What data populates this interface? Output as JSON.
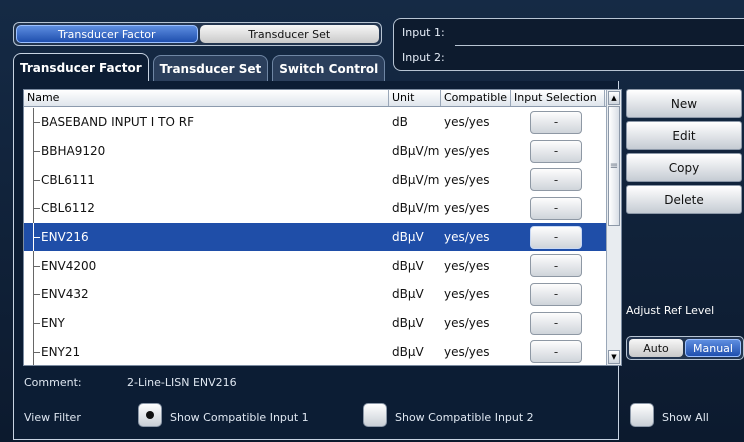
{
  "mode_toggle": {
    "factor_label": "Transducer Factor",
    "set_label": "Transducer Set"
  },
  "inputs": {
    "input1_label": "Input 1:",
    "input2_label": "Input 2:"
  },
  "tabs": [
    "Transducer Factor",
    "Transducer Set",
    "Switch Control"
  ],
  "table": {
    "headers": {
      "name": "Name",
      "unit": "Unit",
      "compatible": "Compatible",
      "input_selection": "Input Selection"
    },
    "rows": [
      {
        "name": "BASEBAND INPUT I TO RF",
        "unit": "dB",
        "compatible": "yes/yes",
        "selection": "-"
      },
      {
        "name": "BBHA9120",
        "unit": "dBµV/m",
        "compatible": "yes/yes",
        "selection": "-"
      },
      {
        "name": "CBL6111",
        "unit": "dBµV/m",
        "compatible": "yes/yes",
        "selection": "-"
      },
      {
        "name": "CBL6112",
        "unit": "dBµV/m",
        "compatible": "yes/yes",
        "selection": "-"
      },
      {
        "name": "ENV216",
        "unit": "dBµV",
        "compatible": "yes/yes",
        "selection": "-",
        "selected": true
      },
      {
        "name": "ENV4200",
        "unit": "dBµV",
        "compatible": "yes/yes",
        "selection": "-"
      },
      {
        "name": "ENV432",
        "unit": "dBµV",
        "compatible": "yes/yes",
        "selection": "-"
      },
      {
        "name": "ENY",
        "unit": "dBµV",
        "compatible": "yes/yes",
        "selection": "-"
      },
      {
        "name": "ENY21",
        "unit": "dBµV",
        "compatible": "yes/yes",
        "selection": "-"
      }
    ]
  },
  "side_buttons": {
    "new": "New",
    "edit": "Edit",
    "copy": "Copy",
    "delete": "Delete"
  },
  "adjust_ref_level": {
    "label": "Adjust Ref Level",
    "auto": "Auto",
    "manual": "Manual"
  },
  "comment": {
    "label": "Comment:",
    "value": "2-Line-LISN ENV216"
  },
  "view_filter": {
    "label": "View Filter",
    "options": [
      "Show Compatible Input 1",
      "Show Compatible Input 2",
      "Show All"
    ],
    "selected_index": 0
  },
  "colors": {
    "accent": "#1f4ea8",
    "background": "#0c1d34"
  }
}
